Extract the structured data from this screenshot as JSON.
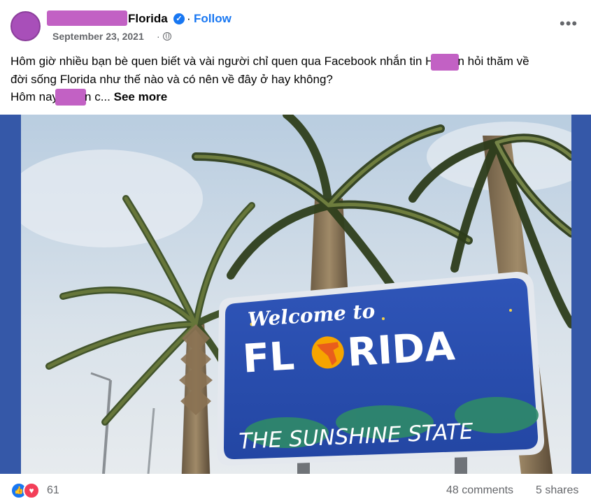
{
  "post": {
    "page_name": "Florida",
    "follow_label": "Follow",
    "dot": "·",
    "date": "September 23, 2021",
    "date_sep": "·",
    "more_icon": "more-horizontal-icon",
    "more_glyph": "•••",
    "text": {
      "line1_a": "Hôm giờ nhiều bạn bè quen biết và vài người chỉ quen qua Facebook nhắn tin H",
      "line1_b": "n hỏi thăm về",
      "line2": "đời sống Florida như thế nào và có nên về đây ở hay không?",
      "line3_a": "Hôm nay",
      "line3_b": "n c...",
      "see_more": "See more"
    },
    "image": {
      "sign_line1": "Welcome to",
      "sign_line2_a": "FL",
      "sign_line2_b": "RIDA",
      "sign_line3": "THE SUNSHINE STATE"
    },
    "footer": {
      "reaction_count": "61",
      "comments": "48 comments",
      "shares": "5 shares"
    }
  },
  "colors": {
    "follow": "#1877f2",
    "sign_blue": "#2a4fb0",
    "redaction": "#c261c4"
  }
}
